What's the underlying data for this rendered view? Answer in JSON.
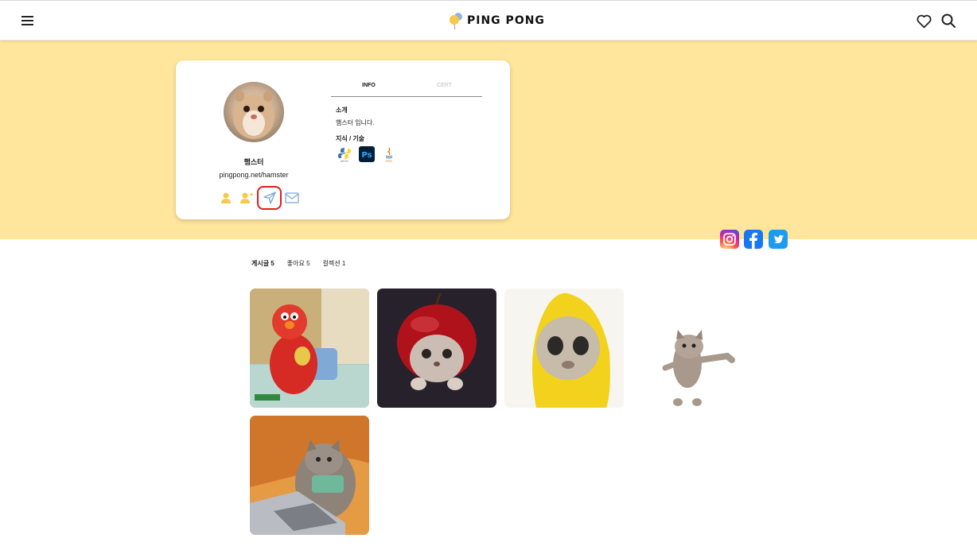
{
  "header": {
    "logo_text": "PING PONG",
    "menu_icon": "hamburger-menu-icon",
    "heart_icon": "heart-icon",
    "search_icon": "search-icon"
  },
  "colors": {
    "banner": "#FFE69C",
    "accent_yellow": "#F5C94A",
    "highlight_red": "#E11C1C",
    "icon_blue": "#7FA7D9"
  },
  "profile": {
    "name": "햄스터",
    "url": "pingpong.net/hamster",
    "tabs": [
      "INFO",
      "CERT"
    ],
    "intro_title": "소개",
    "intro_text": "햄스터 입니다.",
    "skills_title": "지식 / 기술",
    "skills": [
      {
        "name": "python",
        "label": "python"
      },
      {
        "name": "photoshop",
        "label": "Ps"
      },
      {
        "name": "java",
        "label": "java"
      }
    ],
    "actions": [
      "follower-icon",
      "follow-add-icon",
      "send-message-icon",
      "mail-icon"
    ]
  },
  "social": [
    "instagram-icon",
    "facebook-icon",
    "twitter-icon"
  ],
  "post_tabs": [
    {
      "label": "게시글 5"
    },
    {
      "label": "좋아요 5"
    },
    {
      "label": "컬렉션 1"
    }
  ],
  "posts": [
    {
      "name": "elmo-gif"
    },
    {
      "name": "apple-cat-gif"
    },
    {
      "name": "banana-cat-gif"
    },
    {
      "name": "dancing-cat-gif"
    },
    {
      "name": "typing-cat-gif"
    }
  ]
}
